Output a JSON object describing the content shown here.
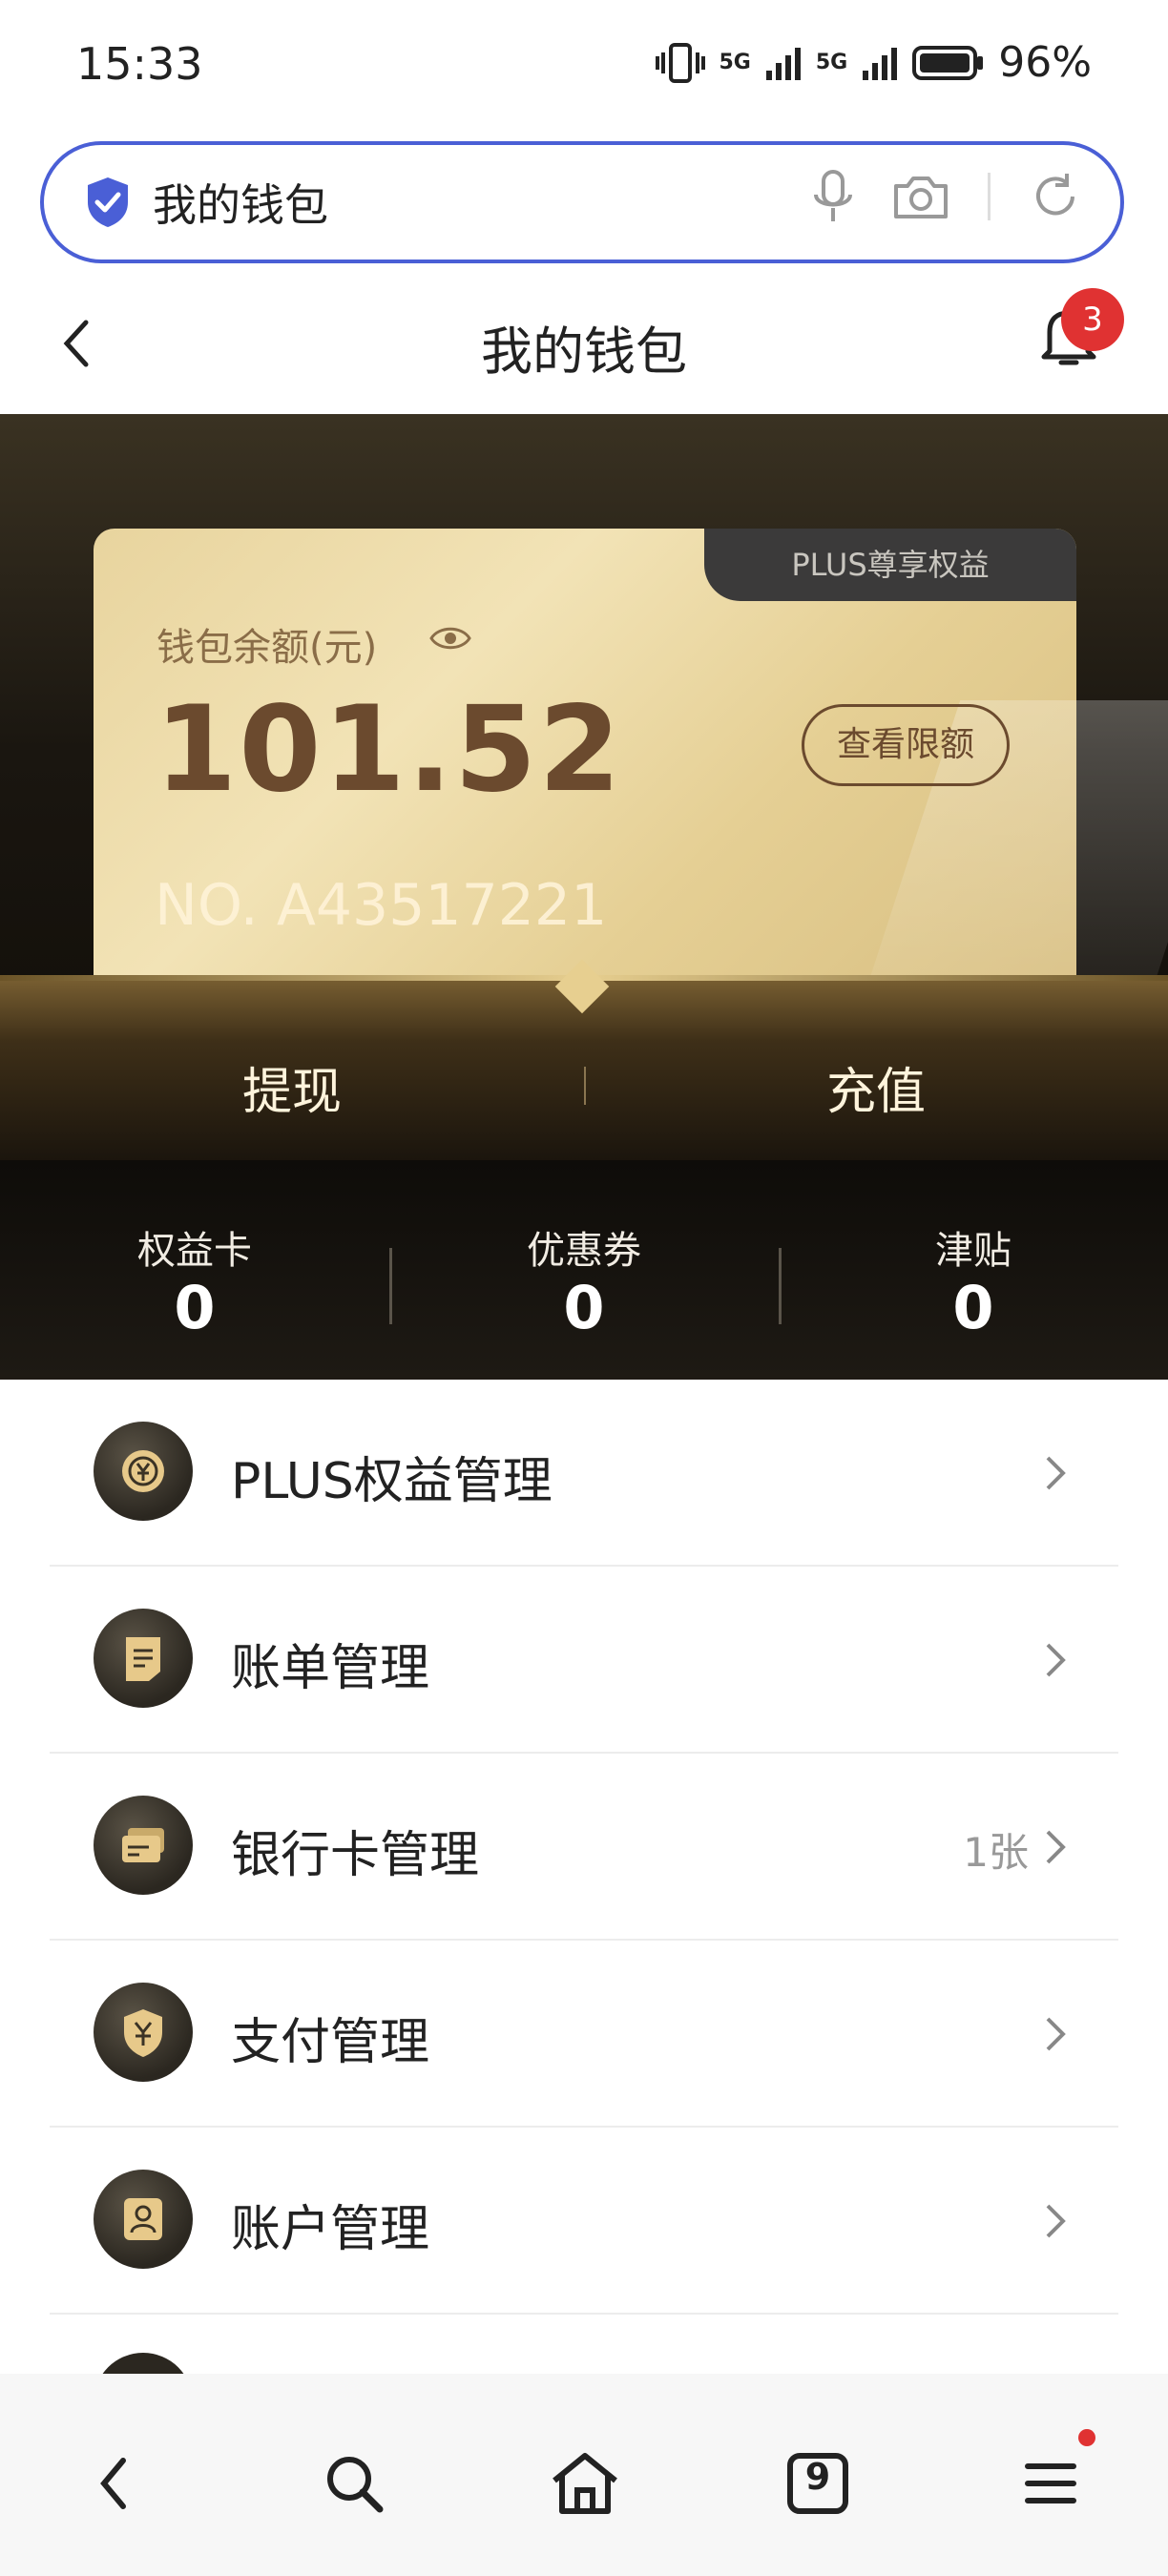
{
  "status_bar": {
    "time": "15:33",
    "signal1": "5G",
    "signal2": "5G",
    "battery": "96%"
  },
  "search": {
    "query": "我的钱包"
  },
  "header": {
    "title": "我的钱包",
    "notification_count": "3"
  },
  "wallet": {
    "tag": "PLUS尊享权益",
    "balance_label": "钱包余额(元)",
    "balance": "101.52",
    "limit_button": "查看限额",
    "card_number": "NO. A43517221",
    "actions": {
      "withdraw": "提现",
      "recharge": "充值"
    }
  },
  "stats": [
    {
      "label": "权益卡",
      "value": "0"
    },
    {
      "label": "优惠券",
      "value": "0"
    },
    {
      "label": "津贴",
      "value": "0"
    }
  ],
  "menu": [
    {
      "title": "PLUS权益管理",
      "meta": "",
      "icon": "plus-coin-icon"
    },
    {
      "title": "账单管理",
      "meta": "",
      "icon": "bill-icon"
    },
    {
      "title": "银行卡管理",
      "meta": "1张",
      "icon": "bank-card-icon"
    },
    {
      "title": "支付管理",
      "meta": "",
      "icon": "yuan-shield-icon"
    },
    {
      "title": "账户管理",
      "meta": "",
      "icon": "user-icon"
    }
  ],
  "bottom_nav": {
    "tab_count": "9"
  },
  "colors": {
    "accent": "#4a5fd6",
    "gold": "#e7cf90",
    "badge": "#e03232"
  }
}
